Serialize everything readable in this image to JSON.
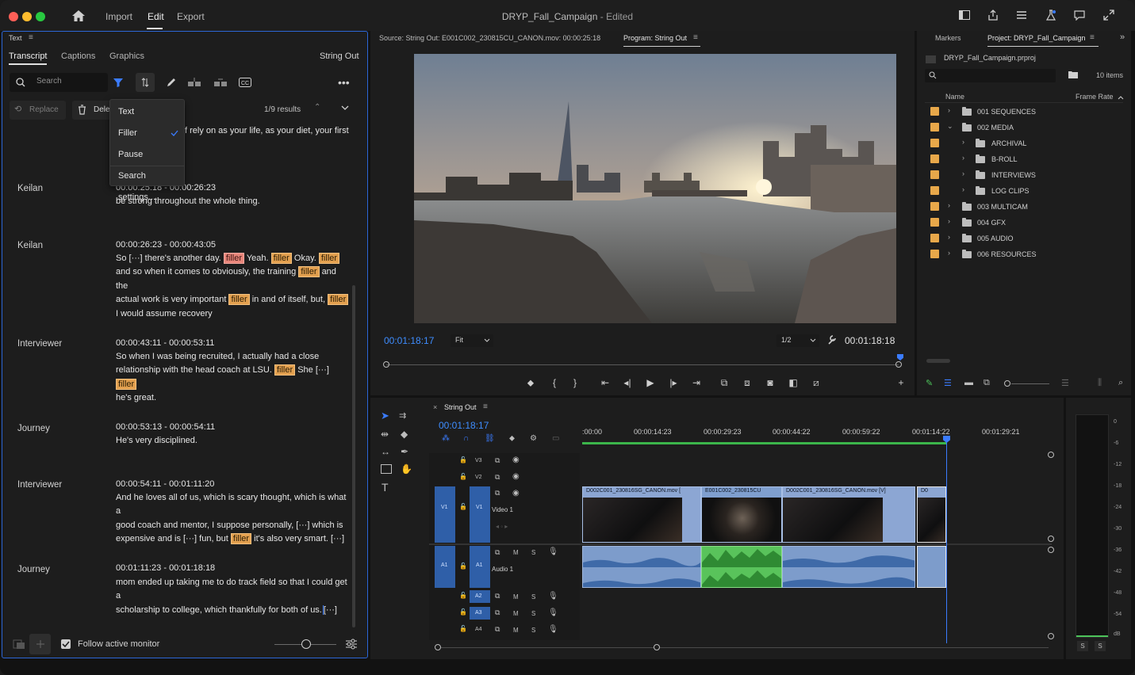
{
  "window": {
    "title": "DRYP_Fall_Campaign",
    "title_suffix": "- Edited",
    "nav": [
      "Import",
      "Edit",
      "Export"
    ],
    "active_nav": "Edit"
  },
  "text_panel": {
    "header": "Text",
    "tabs": [
      "Transcript",
      "Captions",
      "Graphics"
    ],
    "sequence": "String Out",
    "search_placeholder": "Search",
    "replace_label": "Replace",
    "delete_label": "Dele",
    "results": "1/9 results",
    "dropdown": {
      "items": [
        "Text",
        "Filler",
        "Pause",
        "Search settings..."
      ],
      "checked": "Filler"
    },
    "truncated_top": "f rely on as your life, as your diet, your first",
    "entries": [
      {
        "speaker": "Keilan",
        "time": "00:00:25:18 - 00:00:26:23",
        "text": "be strong throughout the whole thing."
      },
      {
        "speaker": "Keilan",
        "time": "00:00:26:23 - 00:00:43:05",
        "lines": [
          "So [···] there's another day.",
          "Yeah.",
          "Okay.",
          "and so when it comes to obviously, the training",
          "and the",
          "actual work is very important",
          "in and of itself, but,",
          "I would assume recovery"
        ]
      },
      {
        "speaker": "Interviewer",
        "time": "00:00:43:11 - 00:00:53:11",
        "lines": [
          "So when I was being recruited, I actually had a close",
          "relationship with the head coach at LSU.",
          "She [···]",
          "he's great."
        ]
      },
      {
        "speaker": "Journey",
        "time": "00:00:53:13 - 00:00:54:11",
        "text": "He's very disciplined."
      },
      {
        "speaker": "Interviewer",
        "time": "00:00:54:11 - 00:01:11:20",
        "lines": [
          "And he loves all of us, which is scary thought, which is what a",
          "good coach and mentor, I suppose personally, [···] which is",
          "expensive and is [···] fun, but",
          "it's also very smart. [···]"
        ]
      },
      {
        "speaker": "Journey",
        "time": "00:01:11:23 - 00:01:18:18",
        "lines": [
          "mom ended up taking me to do track field so that I could get a",
          "scholarship to college, which thankfully for both of us.",
          "[···]"
        ]
      }
    ],
    "filler_tag": "filler",
    "follow_label": "Follow active monitor"
  },
  "monitor": {
    "source_label": "Source: String Out: E001C002_230815CU_CANON.mov: 00:00:25:18",
    "program_label": "Program: String Out",
    "timecode_left": "00:01:18:17",
    "fit": "Fit",
    "resolution": "1/2",
    "timecode_right": "00:01:18:18"
  },
  "project": {
    "tabs": [
      "Markers",
      "Project: DRYP_Fall_Campaign"
    ],
    "file": "DRYP_Fall_Campaign.prproj",
    "item_count": "10 items",
    "col_name": "Name",
    "col_rate": "Frame Rate",
    "items": [
      {
        "name": "001 SEQUENCES",
        "level": 0,
        "open": false
      },
      {
        "name": "002 MEDIA",
        "level": 0,
        "open": true
      },
      {
        "name": "ARCHIVAL",
        "level": 1,
        "open": false
      },
      {
        "name": "B-ROLL",
        "level": 1,
        "open": false
      },
      {
        "name": "INTERVIEWS",
        "level": 1,
        "open": false
      },
      {
        "name": "LOG CLIPS",
        "level": 1,
        "open": false
      },
      {
        "name": "003 MULTICAM",
        "level": 0,
        "open": false
      },
      {
        "name": "004 GFX",
        "level": 0,
        "open": false
      },
      {
        "name": "005 AUDIO",
        "level": 0,
        "open": false
      },
      {
        "name": "006 RESOURCES",
        "level": 0,
        "open": false
      }
    ]
  },
  "timeline": {
    "sequence": "String Out",
    "timecode": "00:01:18:17",
    "ruler": [
      ":00:00",
      "00:00:14:23",
      "00:00:29:23",
      "00:00:44:22",
      "00:00:59:22",
      "00:01:14:22",
      "00:01:29:21"
    ],
    "tracks": [
      "V3",
      "V2",
      "V1",
      "A1",
      "A2",
      "A3",
      "A4"
    ],
    "video_track_name": "Video 1",
    "audio_track_name": "Audio 1",
    "clips": [
      "D002C001_230816SG_CANON.mov [",
      "E001C002_230815CU",
      "D002C001_230816SG_CANON.mov [V]",
      "D0"
    ],
    "meter_labels": [
      "0",
      "-6",
      "-12",
      "-18",
      "-24",
      "-30",
      "-36",
      "-42",
      "-48",
      "-54",
      "dB"
    ],
    "solo": [
      "S",
      "S"
    ],
    "m_label": "M",
    "s_label": "S"
  }
}
